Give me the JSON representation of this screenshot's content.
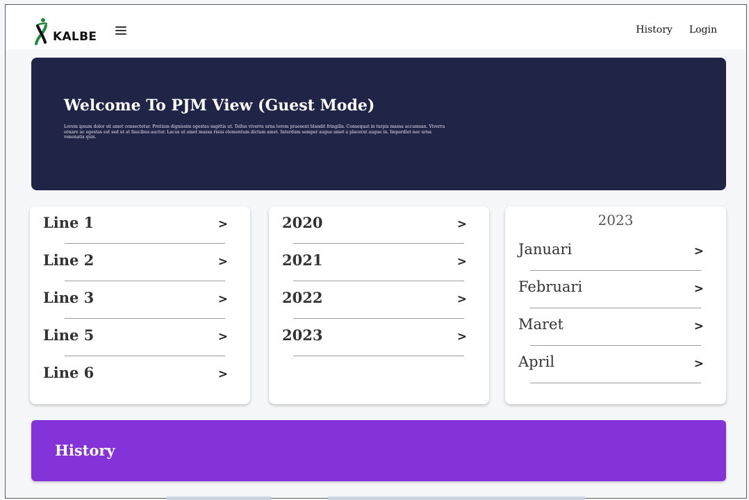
{
  "header": {
    "logo_text": "KALBE",
    "nav": {
      "history": "History",
      "login": "Login"
    }
  },
  "hero": {
    "title": "Welcome To PJM View (Guest Mode)",
    "body": "Lorem ipsum dolor sit amet consectetur. Pretium dignissim egestas sagittis ut. Tellus viverra urna lorem praesent blandit fringilla. Consequat in turpis massa accumsan. Viverra ornare ac egestas est sed ut at faucibus auctor. Lacus ut amet massa risus elementum dictum amet. Interdum semper augue amet a placerat augue in. Imperdiet nec urna venenatis quis."
  },
  "lines": [
    "Line 1",
    "Line 2",
    "Line 3",
    "Line 5",
    "Line 6"
  ],
  "years": [
    "2020",
    "2021",
    "2022",
    "2023"
  ],
  "months_panel": {
    "year": "2023",
    "months": [
      "Januari",
      "Februari",
      "Maret",
      "April"
    ]
  },
  "chevron": ">",
  "history_bar": {
    "label": "History"
  },
  "colors": {
    "hero_bg": "#202447",
    "history_bg": "#8433d8",
    "logo_green": "#1f8a3b"
  }
}
